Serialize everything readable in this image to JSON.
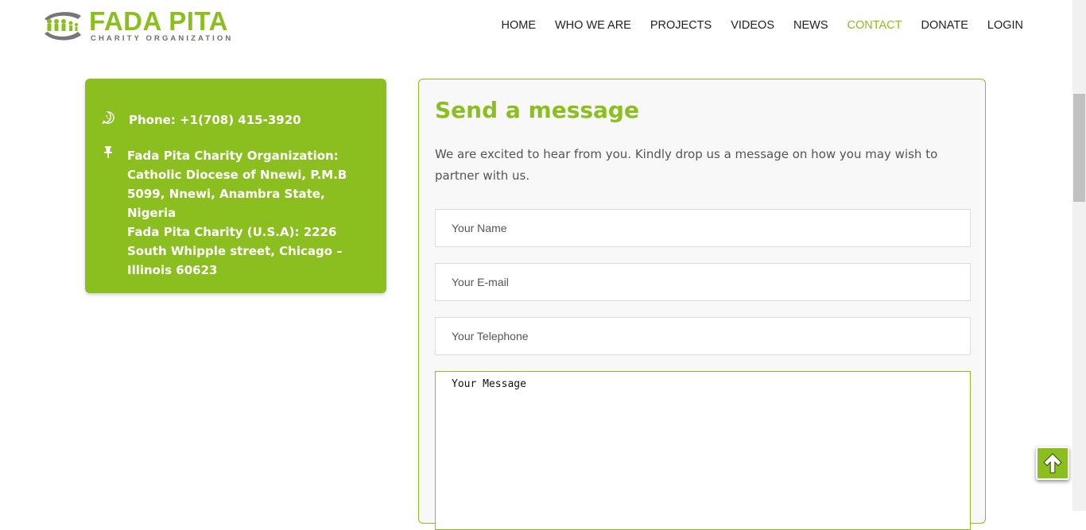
{
  "brand": {
    "title": "FADA PITA",
    "subtitle": "CHARITY ORGANIZATION",
    "accent_color": "#8bbf1f",
    "logo_icon": "people-hands-logo"
  },
  "nav": {
    "items": [
      "HOME",
      "WHO WE ARE",
      "PROJECTS",
      "VIDEOS",
      "NEWS",
      "CONTACT",
      "DONATE",
      "LOGIN"
    ],
    "active": "CONTACT"
  },
  "contact_info": {
    "phone_label": "Phone:",
    "phone_value": "+1(708) 415-3920",
    "phone_icon": "whatsapp-icon",
    "address_icon": "pin-icon",
    "nigeria_label": "Fada Pita Charity Organization:",
    "nigeria_address": "Catholic Diocese of Nnewi, P.M.B 5099, Nnewi, Anambra State, Nigeria",
    "usa_label": "Fada Pita Charity (U.S.A):",
    "usa_address": "2226 South Whipple street, Chicago – Illinois 60623"
  },
  "form": {
    "title": "Send a message",
    "description": "We are excited to hear from you. Kindly drop us a message on how you may wish to partner with us.",
    "name_placeholder": "Your Name",
    "email_placeholder": "Your E-mail",
    "telephone_placeholder": "Your Telephone",
    "message_placeholder": "Your Message"
  },
  "scroll_top_icon": "arrow-up-icon"
}
